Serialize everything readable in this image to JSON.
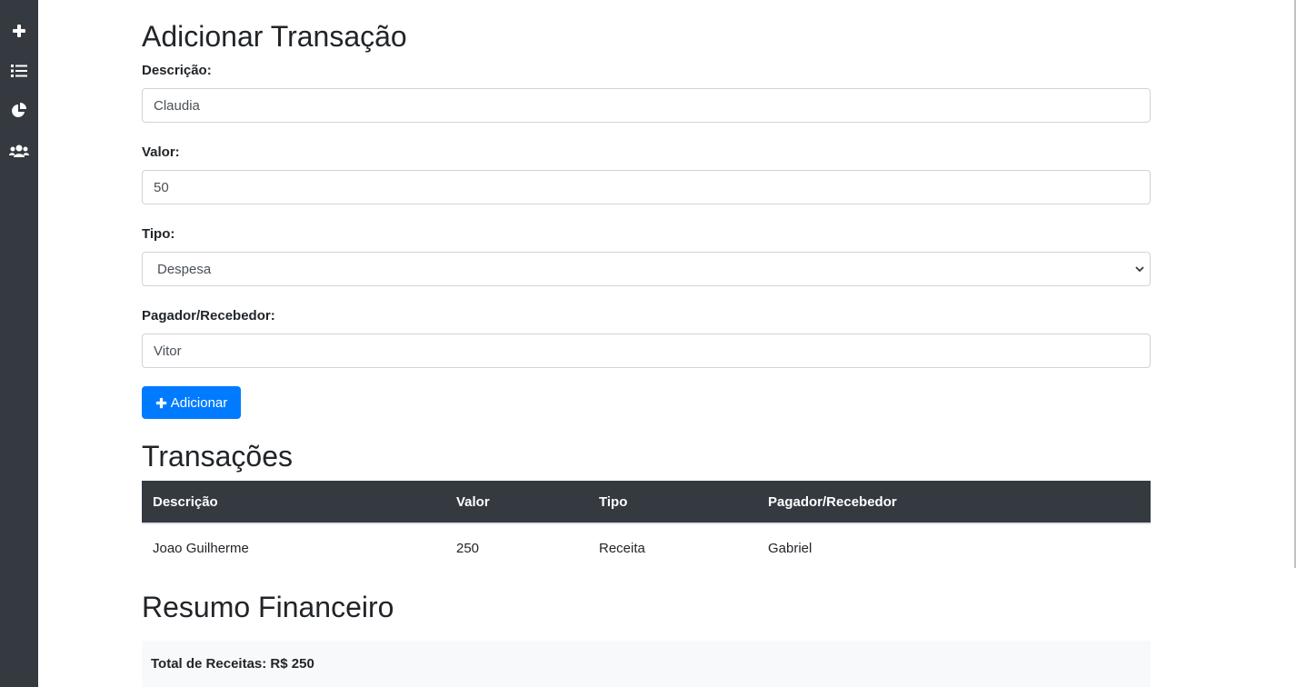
{
  "sidebar": {
    "items": [
      {
        "icon": "plus-icon"
      },
      {
        "icon": "list-icon"
      },
      {
        "icon": "pie-chart-icon"
      },
      {
        "icon": "users-icon"
      }
    ]
  },
  "form": {
    "title": "Adicionar Transação",
    "descricao_label": "Descrição:",
    "descricao_value": "Claudia",
    "valor_label": "Valor:",
    "valor_value": "50",
    "tipo_label": "Tipo:",
    "tipo_value": "Despesa",
    "pagador_label": "Pagador/Recebedor:",
    "pagador_value": "Vitor",
    "add_button_label": "Adicionar"
  },
  "transactions": {
    "title": "Transações",
    "headers": [
      "Descrição",
      "Valor",
      "Tipo",
      "Pagador/Recebedor"
    ],
    "rows": [
      [
        "Joao Guilherme",
        "250",
        "Receita",
        "Gabriel"
      ]
    ]
  },
  "summary": {
    "title": "Resumo Financeiro",
    "total_receitas": "Total de Receitas: R$ 250"
  },
  "colors": {
    "sidebar": "#343a40",
    "primary": "#007bff",
    "table_header": "#343a40",
    "summary_bg": "#f8f9fa"
  }
}
